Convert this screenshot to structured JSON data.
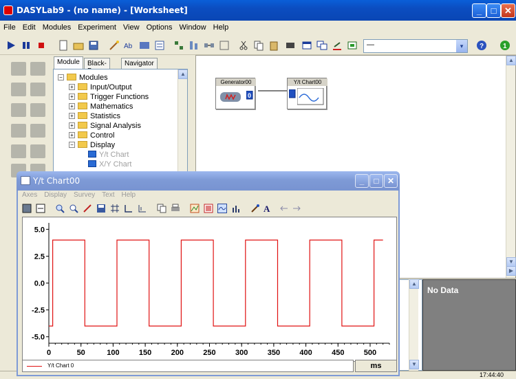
{
  "window": {
    "title": "DASYLab9 - (no name) - [Worksheet]",
    "minimize_glyph": "_",
    "maximize_glyph": "□",
    "close_glyph": "✕"
  },
  "menu": [
    "File",
    "Edit",
    "Modules",
    "Experiment",
    "View",
    "Options",
    "Window",
    "Help"
  ],
  "toolbar": {
    "combo_value": "—",
    "combo_arrow": "▾"
  },
  "tree_panel": {
    "tabs": [
      "Module",
      "Black-Box",
      "Navigator"
    ],
    "items": [
      {
        "label": "Modules",
        "level": 0,
        "expander": "−",
        "kind": "root"
      },
      {
        "label": "Input/Output",
        "level": 1,
        "expander": "+",
        "kind": "folder"
      },
      {
        "label": "Trigger Functions",
        "level": 1,
        "expander": "+",
        "kind": "folder"
      },
      {
        "label": "Mathematics",
        "level": 1,
        "expander": "+",
        "kind": "folder"
      },
      {
        "label": "Statistics",
        "level": 1,
        "expander": "+",
        "kind": "folder"
      },
      {
        "label": "Signal Analysis",
        "level": 1,
        "expander": "+",
        "kind": "folder"
      },
      {
        "label": "Control",
        "level": 1,
        "expander": "+",
        "kind": "folder"
      },
      {
        "label": "Display",
        "level": 1,
        "expander": "−",
        "kind": "folder"
      },
      {
        "label": "Y/t Chart",
        "level": 2,
        "expander": "",
        "kind": "module"
      },
      {
        "label": "X/Y Chart",
        "level": 2,
        "expander": "",
        "kind": "module"
      }
    ]
  },
  "worksheet": {
    "modules": [
      {
        "name": "Generator00"
      },
      {
        "name": "Y/t Chart00"
      }
    ]
  },
  "right_panel": {
    "message": "No Data"
  },
  "statusbar": {
    "clock": "17:44:40"
  },
  "chart_window": {
    "title": "Y/t Chart00",
    "menu": [
      "Axes",
      "Display",
      "Survey",
      "Text",
      "Help"
    ],
    "legend_label": "Y/t Chart 0",
    "unit_label": "ms",
    "colors": {
      "signal": "#e01010",
      "titlebar": "#7e9ad6"
    }
  },
  "chart_data": {
    "type": "line",
    "title": "",
    "xlabel": "ms",
    "ylabel": "",
    "xlim": [
      0,
      530
    ],
    "ylim": [
      -5.6,
      5.6
    ],
    "xticks": [
      0,
      50,
      100,
      150,
      200,
      250,
      300,
      350,
      400,
      450,
      500
    ],
    "yticks": [
      5.0,
      2.5,
      0.0,
      -2.5,
      -5.0
    ],
    "ytick_labels": [
      "5.0",
      "2.5",
      "0.0",
      "-2.5",
      "-5.0"
    ],
    "grid": false,
    "series": [
      {
        "name": "Y/t Chart 0",
        "color": "#e01010",
        "x": [
          0,
          6,
          6,
          56,
          56,
          106,
          106,
          156,
          156,
          206,
          206,
          256,
          256,
          306,
          306,
          356,
          356,
          406,
          406,
          456,
          456,
          506,
          506,
          520
        ],
        "y": [
          -4,
          -4,
          4,
          4,
          -4,
          -4,
          4,
          4,
          -4,
          -4,
          4,
          4,
          -4,
          -4,
          4,
          4,
          -4,
          -4,
          4,
          4,
          -4,
          -4,
          4,
          4
        ]
      }
    ]
  }
}
